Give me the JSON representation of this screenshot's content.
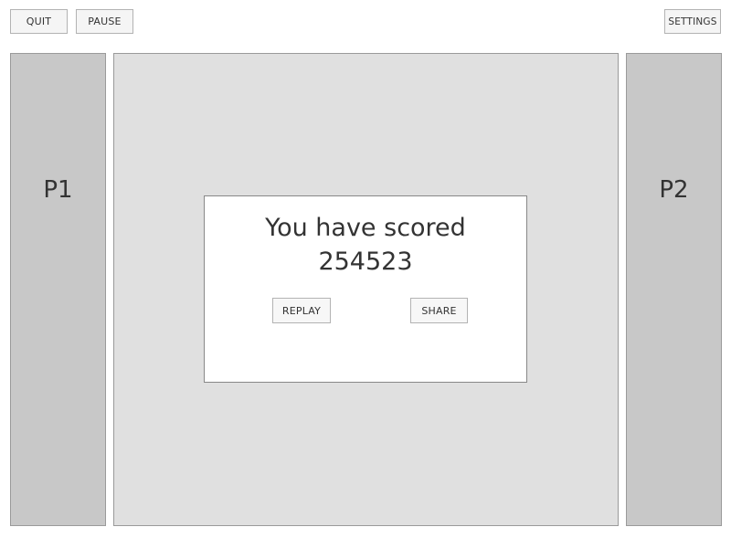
{
  "toolbar": {
    "quit_label": "QUIT",
    "pause_label": "PAUSE",
    "settings_label": "SETTINGS"
  },
  "players": {
    "p1_label": "P1",
    "p2_label": "P2"
  },
  "dialog": {
    "title": "You have scored",
    "score": "254523",
    "replay_label": "REPLAY",
    "share_label": "SHARE"
  },
  "colors": {
    "panel": "#c8c8c8",
    "field": "#e0e0e0",
    "dialog": "#ffffff",
    "button": "#f5f5f5",
    "border": "#9a9a9a",
    "text": "#333333"
  }
}
